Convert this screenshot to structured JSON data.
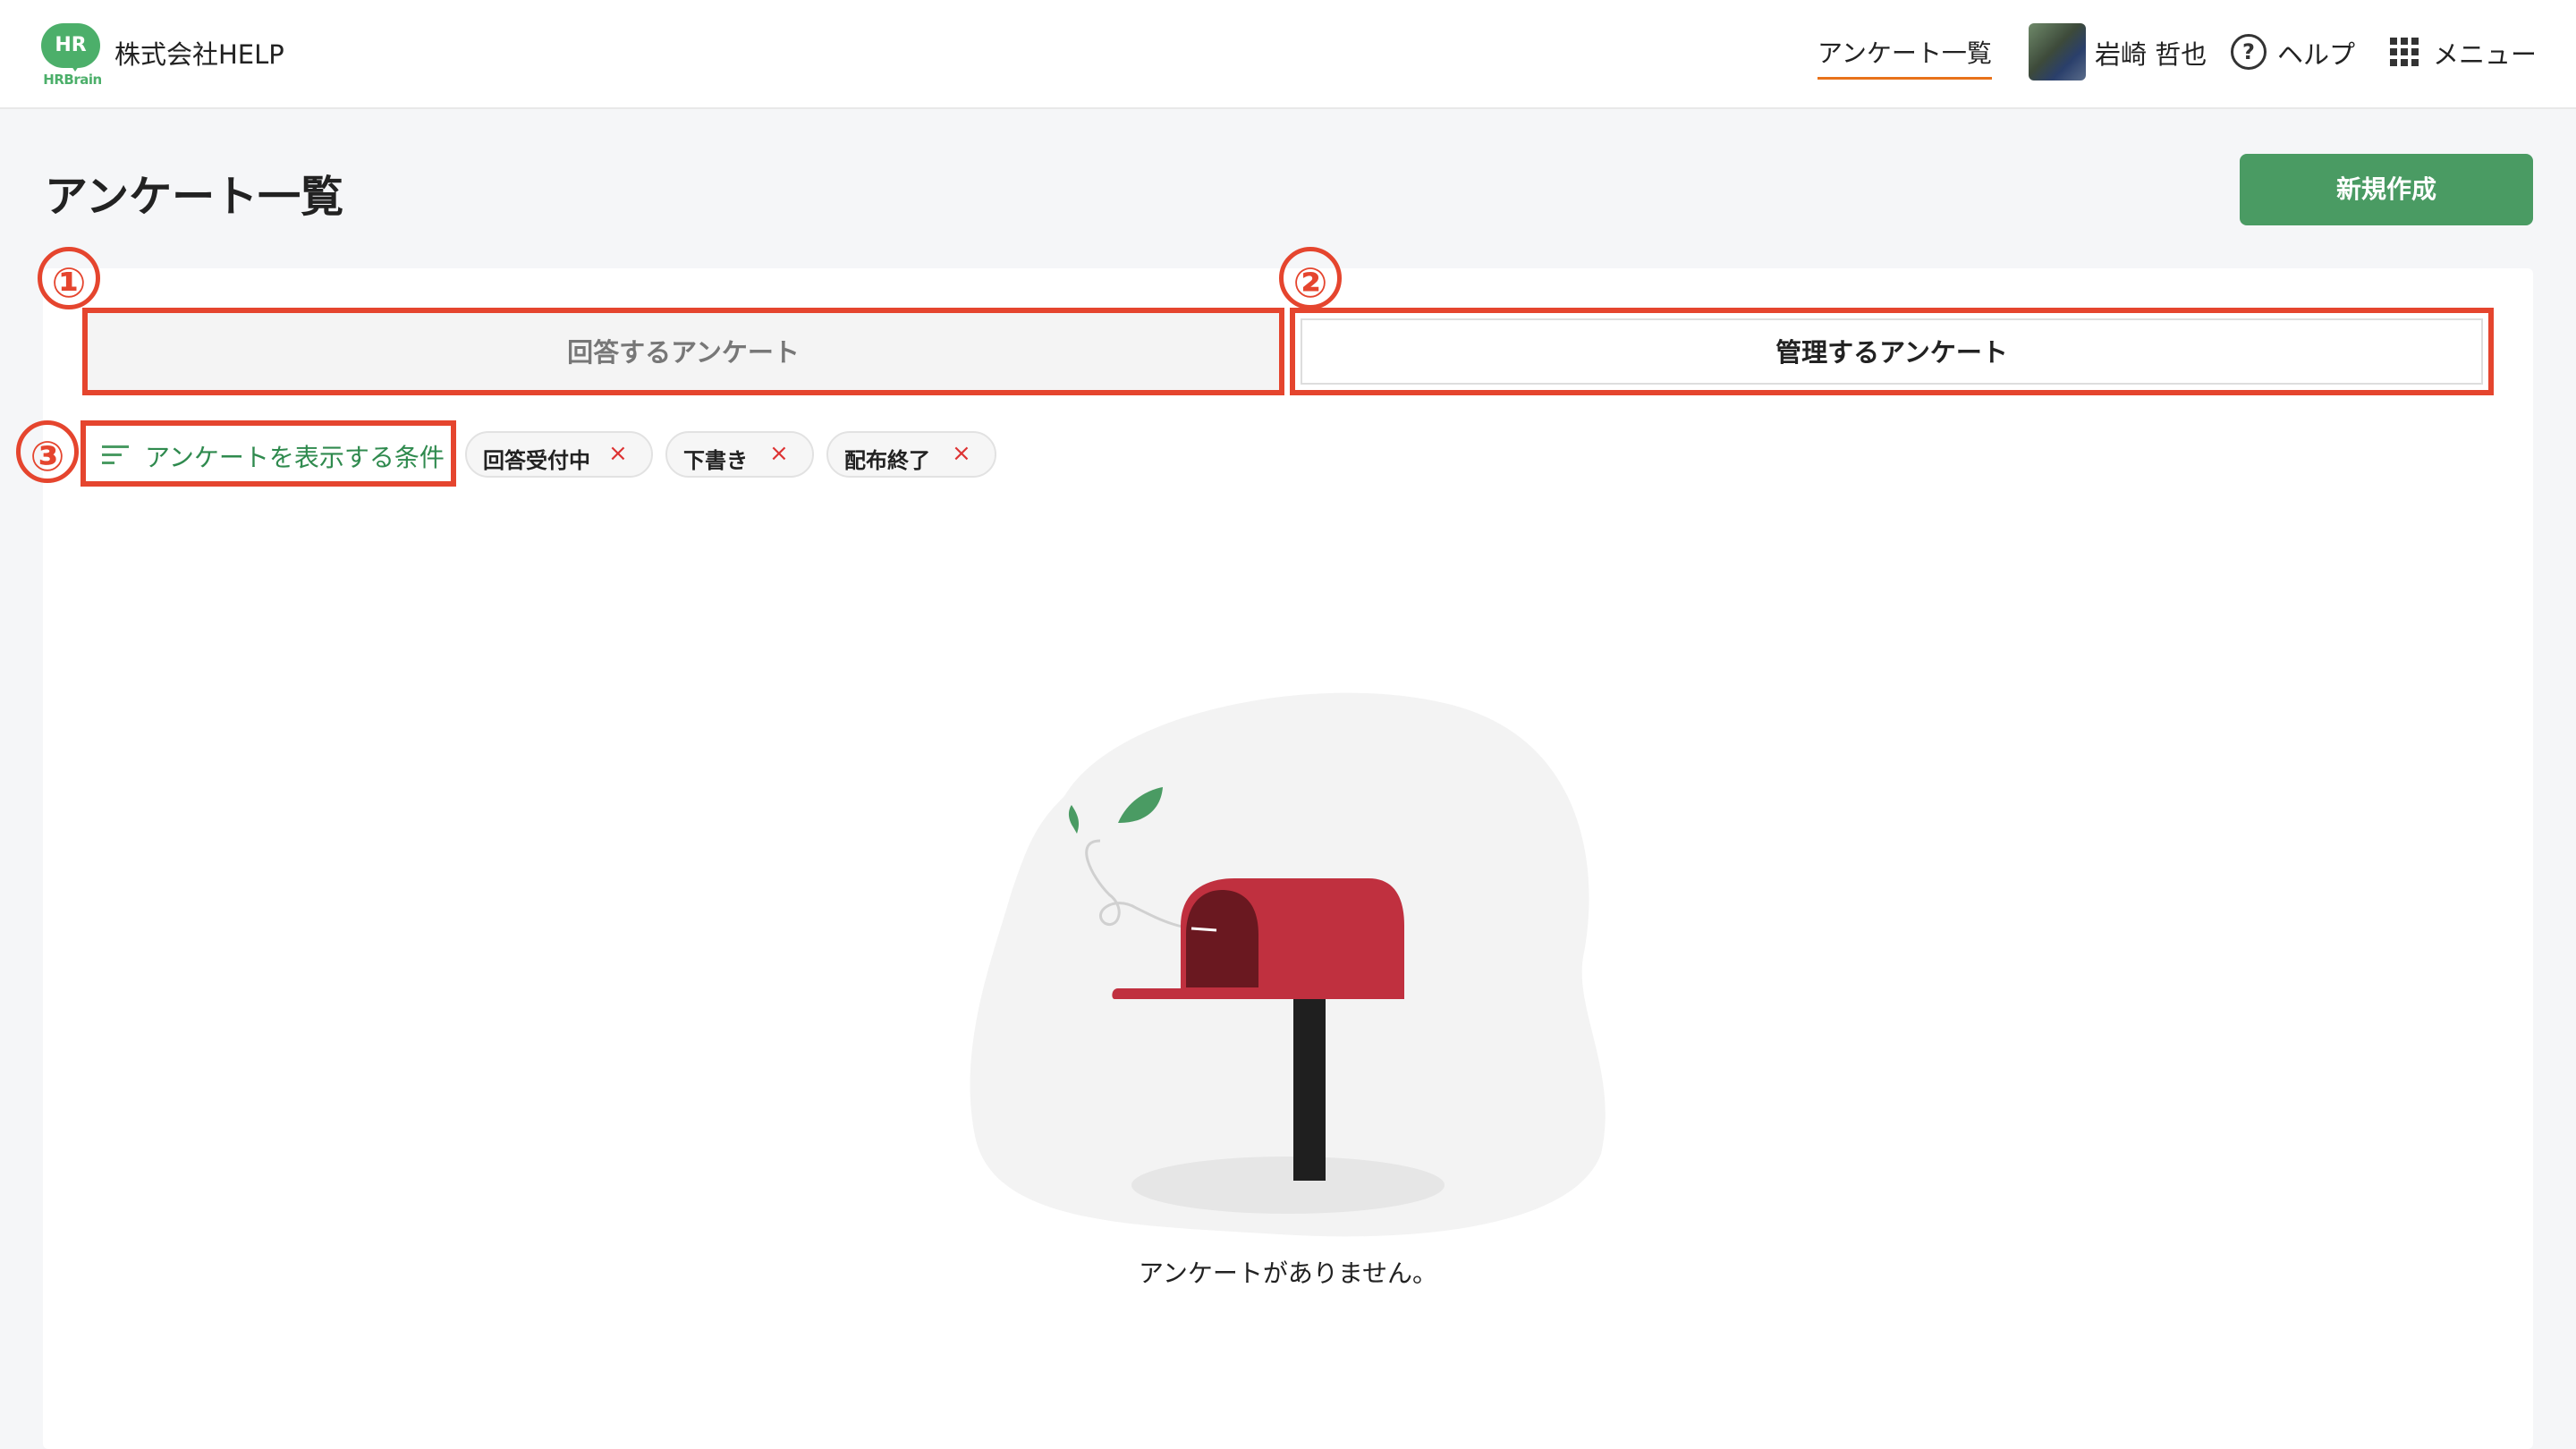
{
  "header": {
    "logo_text": "HR",
    "logo_sub": "HRBrain",
    "company": "株式会社HELP",
    "nav_active": "アンケート一覧",
    "user_name": "岩崎 哲也",
    "help_label": "ヘルプ",
    "menu_label": "メニュー"
  },
  "main": {
    "title": "アンケート一覧",
    "new_button": "新規作成",
    "tabs": [
      {
        "label": "回答するアンケート",
        "selected": false
      },
      {
        "label": "管理するアンケート",
        "selected": true
      }
    ],
    "filter_label": "アンケートを表示する条件",
    "chips": [
      {
        "label": "回答受付中",
        "remove": "×"
      },
      {
        "label": "下書き",
        "remove": "×"
      },
      {
        "label": "配布終了",
        "remove": "×"
      }
    ],
    "empty_message": "アンケートがありません。"
  },
  "annotations": [
    "①",
    "②",
    "③"
  ],
  "colors": {
    "accent_green": "#4a9b63",
    "annotation_red": "#e5452e",
    "nav_underline": "#e8721a",
    "mailbox_red": "#c0303f"
  }
}
